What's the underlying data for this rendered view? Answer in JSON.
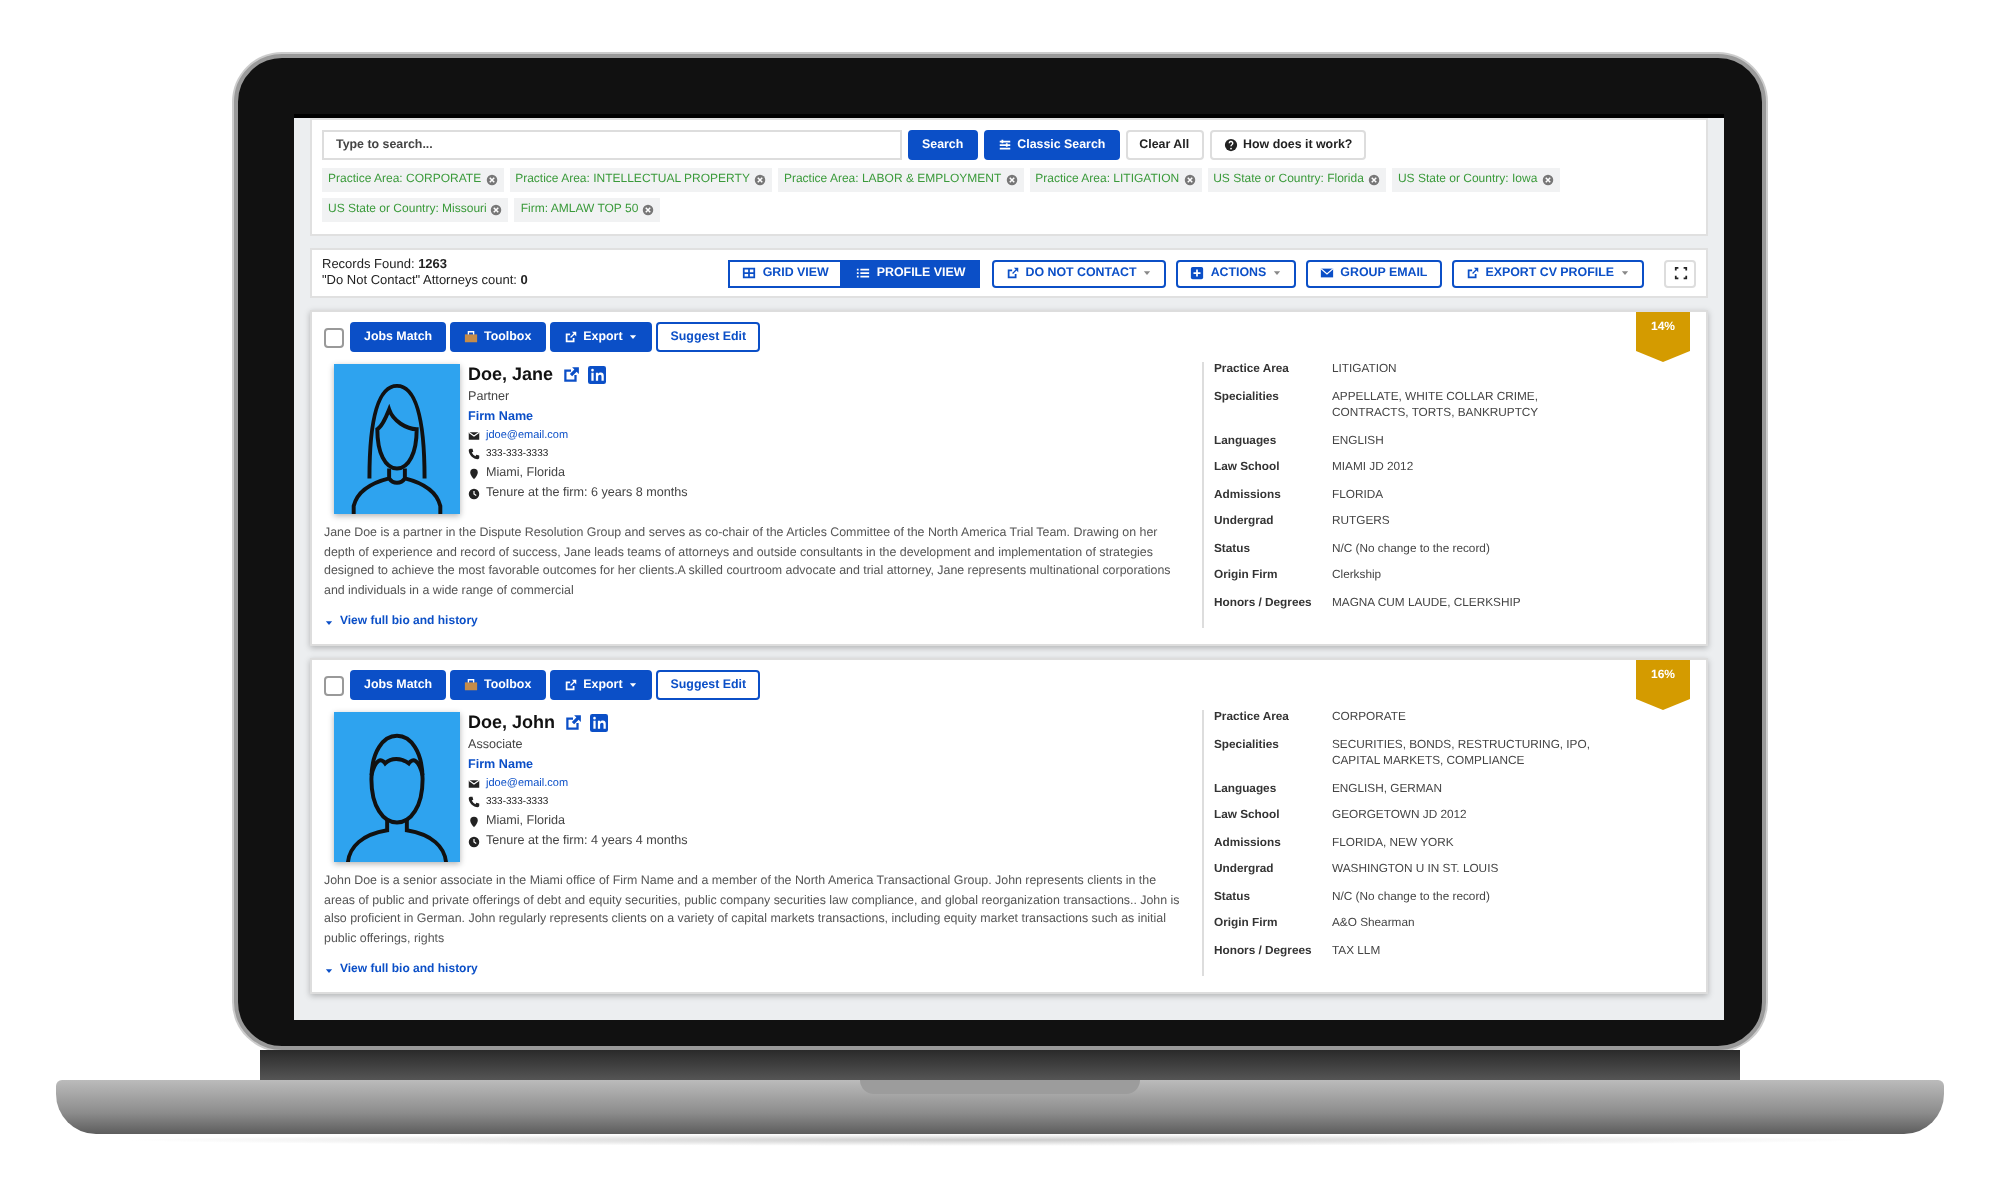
{
  "search": {
    "placeholder": "Type to search...",
    "buttons": [
      {
        "label": "Search",
        "kind": "primary"
      },
      {
        "label": "Classic Search",
        "kind": "classic"
      },
      {
        "label": "Clear All",
        "kind": "plain"
      },
      {
        "label": "How does it work?",
        "kind": "help"
      }
    ],
    "filters": [
      "Practice Area: CORPORATE",
      "Practice Area: INTELLECTUAL PROPERTY",
      "Practice Area: LABOR & EMPLOYMENT",
      "Practice Area: LITIGATION",
      "US State or Country: Florida",
      "US State or Country: Iowa",
      "US State or Country: Missouri",
      "Firm: AMLAW TOP 50"
    ]
  },
  "records": {
    "found": "Records Found: **1263**",
    "dnc": "\"Do Not Contact\" Attorneys count: **0**",
    "views": [
      {
        "label": "GRID VIEW",
        "selected": false
      },
      {
        "label": "PROFILE VIEW",
        "selected": true
      }
    ],
    "actions": [
      {
        "label": "DO NOT CONTACT",
        "kind": "export",
        "dropdown": true
      },
      {
        "label": "ACTIONS",
        "kind": "plus",
        "dropdown": true
      },
      {
        "label": "GROUP EMAIL",
        "kind": "mail",
        "dropdown": false
      },
      {
        "label": "EXPORT CV PROFILE",
        "kind": "export",
        "dropdown": true
      }
    ]
  },
  "profiles": [
    {
      "buttons": [
        {
          "label": "Jobs Match",
          "kind": "solid"
        },
        {
          "label": "Toolbox",
          "kind": "toolbox"
        },
        {
          "label": "Export",
          "kind": "export"
        },
        {
          "label": "Suggest Edit",
          "kind": "outline"
        }
      ],
      "checked": false,
      "avatar": {
        "kind": "female"
      },
      "name": "Doe, Jane",
      "title": "Partner",
      "firm": "Firm Name",
      "email": "jdoe@email.com",
      "phone": "333-333-3333",
      "location": "Miami, Florida",
      "tenure": "Tenure at the firm: 6 years 8 months",
      "match": "14%",
      "bio": "Jane Doe  is a partner in the Dispute Resolution Group and serves as co-chair of the Articles Committee of the North America Trial Team. Drawing on her depth of experience and record of success, Jane leads teams of attorneys and outside consultants in the development and implementation of strategies designed to achieve the most favorable outcomes for her clients.A skilled courtroom advocate and trial attorney, Jane represents multinational corporations and individuals in a wide range of commercial",
      "more": "View full bio and history",
      "details": [
        {
          "label": "Practice Area",
          "value": "LITIGATION"
        },
        {
          "label": "Specialities",
          "value": "APPELLATE, WHITE COLLAR CRIME, CONTRACTS, TORTS, BANKRUPTCY"
        },
        {
          "label": "Languages",
          "value": "ENGLISH"
        },
        {
          "label": "Law School",
          "value": "MIAMI JD 2012"
        },
        {
          "label": "Admissions",
          "value": "FLORIDA"
        },
        {
          "label": "Undergrad",
          "value": "RUTGERS"
        },
        {
          "label": "Status",
          "value": "N/C (No change to the record)"
        },
        {
          "label": "Origin Firm",
          "value": "Clerkship"
        },
        {
          "label": "Honors / Degrees",
          "value": "MAGNA CUM LAUDE, CLERKSHIP"
        }
      ]
    },
    {
      "buttons": [
        {
          "label": "Jobs Match",
          "kind": "solid"
        },
        {
          "label": "Toolbox",
          "kind": "toolbox"
        },
        {
          "label": "Export",
          "kind": "export"
        },
        {
          "label": "Suggest Edit",
          "kind": "outline"
        }
      ],
      "checked": false,
      "avatar": {
        "kind": "male"
      },
      "name": "Doe, John",
      "title": "Associate",
      "firm": "Firm Name",
      "email": "jdoe@email.com",
      "phone": "333-333-3333",
      "location": "Miami, Florida",
      "tenure": "Tenure at the firm: 4 years 4 months",
      "match": "16%",
      "bio": "John Doe     is a senior associate in the Miami office of     Firm Name     and a member of the North America Transactional Group. John represents clients in the areas of public and private offerings of debt and equity securities, public company securities law compliance, and global reorganization transactions.. John is also proficient in German. John regularly represents clients on a variety of capital markets transactions, including equity market transactions such as initial public offerings, rights",
      "more": "View full bio and history",
      "details": [
        {
          "label": "Practice Area",
          "value": "CORPORATE"
        },
        {
          "label": "Specialities",
          "value": "SECURITIES, BONDS, RESTRUCTURING, IPO, CAPITAL MARKETS, COMPLIANCE"
        },
        {
          "label": "Languages",
          "value": "ENGLISH, GERMAN"
        },
        {
          "label": "Law School",
          "value": "GEORGETOWN JD 2012"
        },
        {
          "label": "Admissions",
          "value": "FLORIDA, NEW YORK"
        },
        {
          "label": "Undergrad",
          "value": "WASHINGTON U IN ST. LOUIS"
        },
        {
          "label": "Status",
          "value": "N/C (No change to the record)"
        },
        {
          "label": "Origin Firm",
          "value": "A&O Shearman"
        },
        {
          "label": "Honors / Degrees",
          "value": "TAX LLM"
        }
      ]
    }
  ]
}
